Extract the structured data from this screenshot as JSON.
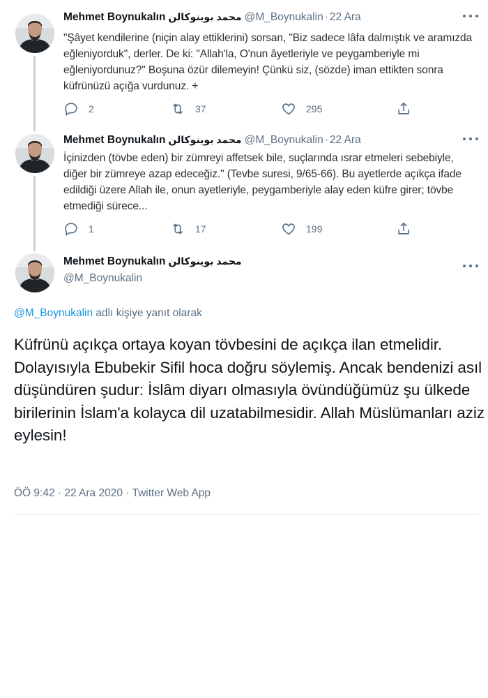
{
  "author": {
    "name": "Mehmet Boynukalın",
    "arabic_name": "محمد بوينوكالن",
    "handle": "@M_Boynukalin"
  },
  "tweets": [
    {
      "date": "22 Ara",
      "text": "\"Şâyet kendilerine (niçin alay ettiklerini) sorsan, \"Biz sadece lâfa dalmıştık ve aramızda eğleniyorduk\", derler. De ki: \"Allah'la, O'nun âyetleriyle ve peygamberiyle mi eğleniyordunuz?\" Boşuna özür dilemeyin! Çünkü siz, (sözde) iman ettikten sonra küfrünüzü açığa vurdunuz. +",
      "replies": "2",
      "retweets": "37",
      "likes": "295"
    },
    {
      "date": "22 Ara",
      "text": "İçinizden (tövbe eden) bir zümreyi affetsek bile, suçlarında ısrar etmeleri sebebiyle, diğer bir zümreye azap edeceğiz.\" (Tevbe suresi, 9/65-66). Bu ayetlerde açıkça ifade edildiği üzere Allah ile, onun ayetleriyle, peygamberiyle alay eden küfre girer; tövbe etmediği sürece...",
      "replies": "1",
      "retweets": "17",
      "likes": "199"
    }
  ],
  "main_tweet": {
    "reply_mention": "@M_Boynukalin",
    "reply_suffix": " adlı kişiye yanıt olarak",
    "text": "Küfrünü açıkça ortaya koyan tövbesini de açıkça ilan etmelidir. Dolayısıyla Ebubekir Sifil hoca doğru söylemiş. Ancak bendenizi asıl düşündüren şudur: İslâm diyarı olmasıyla övündüğümüz şu ülkede birilerinin İslam'a kolayca dil uzatabilmesidir. Allah Müslümanları aziz eylesin!",
    "timestamp": "ÖÖ 9:42 · 22 Ara 2020 · Twitter Web App"
  },
  "separator": "·",
  "icons": {
    "reply": "reply-icon",
    "retweet": "retweet-icon",
    "like": "heart-icon",
    "share": "share-icon",
    "more": "more-icon"
  },
  "colors": {
    "link": "#1b95e0",
    "secondary_text": "#5b7083",
    "thread_line": "#c8d1d8"
  }
}
